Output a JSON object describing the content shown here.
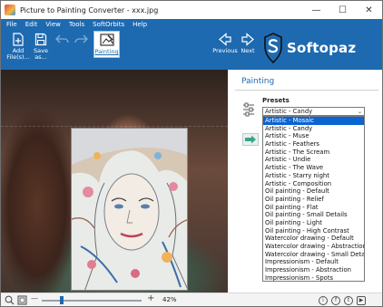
{
  "window": {
    "title": "Picture to Painting Converter - xxx.jpg",
    "minimize_glyph": "—",
    "maximize_glyph": "☐",
    "close_glyph": "✕"
  },
  "menu": [
    "File",
    "Edit",
    "View",
    "Tools",
    "SoftOrbits",
    "Help"
  ],
  "toolbar": {
    "add_files_label": "Add\nFile(s)...",
    "save_as_label": "Save\nas...",
    "painting_label": "Painting",
    "previous_label": "Previous",
    "next_label": "Next",
    "logo_text": "Softopaz"
  },
  "side_panel": {
    "title": "Painting",
    "presets_label": "Presets",
    "selected_preset": "Artistic - Candy",
    "dropdown_arrow": "⌄",
    "options": [
      "Artistic - Mosaic",
      "Artistic - Candy",
      "Artistic - Muse",
      "Artistic - Feathers",
      "Artistic - The Scream",
      "Artistic - Undie",
      "Artistic - The Wave",
      "Artistic - Starry night",
      "Artistic - Composition",
      "Oil painting - Default",
      "Oil painting - Relief",
      "Oil painting - Flat",
      "Oil painting - Small Details",
      "Oil painting - Light",
      "Oil painting - High Contrast",
      "Watercolor drawing - Default",
      "Watercolor drawing - Abstraction",
      "Watercolor drawing - Small Details",
      "Impressionism - Default",
      "Impressionism - Abstraction",
      "Impressionism - Spots"
    ],
    "highlighted_option": "Artistic - Mosaic"
  },
  "status": {
    "zoom_level": "42%",
    "zoom_fraction": 0.2,
    "zoom_out_glyph": "—",
    "zoom_in_glyph": "+"
  },
  "colors": {
    "accent": "#1e6ab0",
    "selection": "#0a64d2"
  },
  "icons": {
    "zoom": "magnifier-icon",
    "fit": "fit-screen-icon",
    "info": "info-icon",
    "twitter": "twitter-icon",
    "facebook": "facebook-icon",
    "youtube": "youtube-icon"
  }
}
